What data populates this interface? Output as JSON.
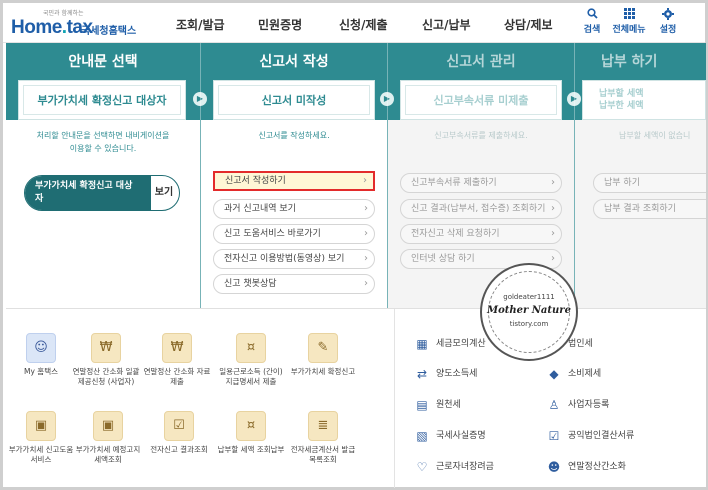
{
  "header": {
    "logo_tagline": "국민과 함께하는",
    "logo_text_a": "Home",
    "logo_text_b": "tax",
    "logo_sub": "국세청홈택스",
    "nav": [
      "조회/발급",
      "민원증명",
      "신청/제출",
      "신고/납부",
      "상담/제보"
    ],
    "tools": [
      {
        "label": "검색",
        "icon": "search-icon"
      },
      {
        "label": "전체메뉴",
        "icon": "grid-menu-icon"
      },
      {
        "label": "설정",
        "icon": "gear-icon"
      }
    ]
  },
  "steps": {
    "guide": {
      "title": "안내문 선택",
      "box": "부가가치세 확정신고 대상자",
      "desc_1": "처리할 안내문을 선택하면 내비게이션을",
      "desc_2": "이용할 수 있습니다.",
      "pill_label_1": "부가가치세 확정신고 대상",
      "pill_label_2": "자",
      "pill_button": "보기"
    },
    "write": {
      "title": "신고서 작성",
      "box": "신고서 미작성",
      "desc": "신고서를 작성하세요.",
      "items": [
        "신고서 작성하기",
        "과거 신고내역 보기",
        "신고 도움서비스 바로가기",
        "전자신고 이용방법(동영상) 보기",
        "신고 챗봇상담"
      ]
    },
    "manage": {
      "title": "신고서 관리",
      "box": "신고부속서류 미제출",
      "desc": "신고부속서류를 제출하세요.",
      "items": [
        "신고부속서류 제출하기",
        "신고 결과(납부서, 접수증) 조회하기",
        "전자신고 삭제 요청하기",
        "인터넷 상담 하기"
      ]
    },
    "pay": {
      "title": "납부 하기",
      "box_1": "납부할 세액",
      "box_2": "납부한 세액",
      "desc": "납부할 세액이 없습니",
      "items": [
        "납부 하기",
        "납부 결과 조회하기"
      ]
    }
  },
  "tiles": [
    {
      "label": "My 홈택스",
      "icon": "person-icon"
    },
    {
      "label": "연말정산 간소화 일괄제공신청 (사업자)",
      "icon": "money-bag-icon"
    },
    {
      "label": "연말정산 간소화 자료제출",
      "icon": "money-bag-icon"
    },
    {
      "label": "일용근로소득 (간이)지급명세서 제출",
      "icon": "coin-document-icon"
    },
    {
      "label": "부가가치세 확정신고",
      "icon": "vat-document-icon"
    },
    {
      "label": "부가가치세 신고도움 서비스",
      "icon": "monitor-icon"
    },
    {
      "label": "부가가치세 예정고지 세액조회",
      "icon": "monitor-icon"
    },
    {
      "label": "전자신고 결과조회",
      "icon": "checklist-icon"
    },
    {
      "label": "납부할 세액 조회납부",
      "icon": "coin-document-icon"
    },
    {
      "label": "전자세금계산서 발급목록조회",
      "icon": "document-list-icon"
    }
  ],
  "taxes": [
    {
      "label": "세금모의계산",
      "icon": "calculator-icon"
    },
    {
      "label": "법인세",
      "icon": "building-icon"
    },
    {
      "label": "양도소득세",
      "icon": "transfer-icon"
    },
    {
      "label": "소비제세",
      "icon": "diamond-icon"
    },
    {
      "label": "원천세",
      "icon": "withholding-icon"
    },
    {
      "label": "사업자등록",
      "icon": "person-outline-icon"
    },
    {
      "label": "국세사실증명",
      "icon": "certificate-icon"
    },
    {
      "label": "공익법인결산서류",
      "icon": "clipboard-icon"
    },
    {
      "label": "근로자녀장려금",
      "icon": "heart-hand-icon"
    },
    {
      "label": "연말정산간소화",
      "icon": "people-icon"
    }
  ],
  "seal": {
    "line1": "goldeater1111",
    "line2": "Mother Nature",
    "line3": "tistory.com"
  },
  "colors": {
    "panel": "#2e8b91",
    "brand": "#1f5ea8",
    "highlight_border": "#e32b2b"
  }
}
